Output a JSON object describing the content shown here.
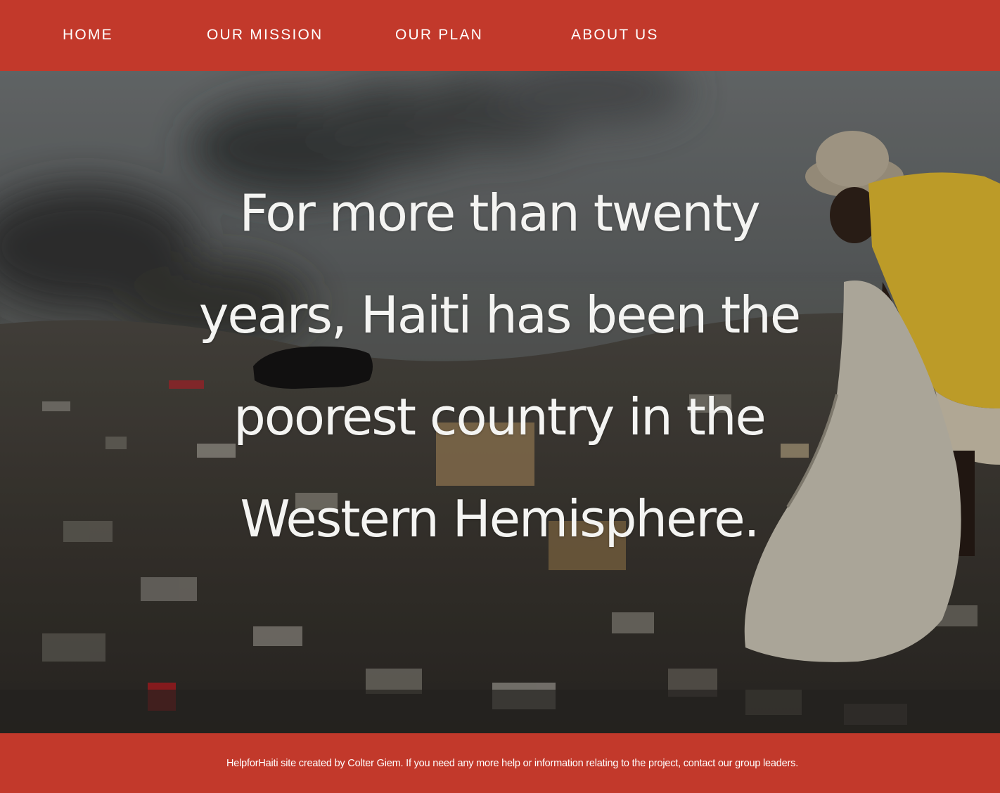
{
  "colors": {
    "brand_red": "#c2392b",
    "text_white": "#ffffff",
    "headline_white": "#f4f4f2"
  },
  "nav": {
    "items": [
      {
        "label": "HOME"
      },
      {
        "label": "OUR MISSION"
      },
      {
        "label": "OUR PLAN"
      },
      {
        "label": "ABOUT US"
      }
    ]
  },
  "hero": {
    "headline": "For more than twenty years, Haiti has been the poorest country in the Western Hemisphere."
  },
  "footer": {
    "text": "HelpforHaiti site created by Colter Giem. If you need any more help or information relating to the project, contact our group leaders."
  }
}
